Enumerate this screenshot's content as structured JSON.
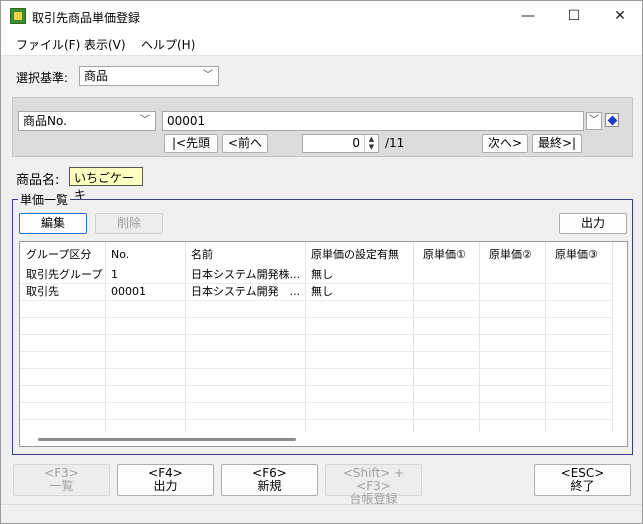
{
  "window": {
    "title": "取引先商品単価登録",
    "minimize": "—",
    "maximize": "☐",
    "close": "✕"
  },
  "menu": {
    "file": "ファイル(F)",
    "view": "表示(V)",
    "help": "ヘルプ(H)"
  },
  "criteria": {
    "label": "選択基準:",
    "value": "商品"
  },
  "search": {
    "field": "商品No.",
    "value": "00001",
    "first": "|<先頭",
    "prev": "<前へ",
    "position": "0",
    "total": "/11",
    "next": "次へ>",
    "last": "最終>|"
  },
  "product_name": {
    "label": "商品名:",
    "value": "いちごケーキ"
  },
  "price_list": {
    "title": "単価一覧",
    "edit": "編集",
    "delete": "削除",
    "output": "出力",
    "columns": [
      "グループ区分",
      "No.",
      "名前",
      "原単価の設定有無",
      "原単価①",
      "原単価②",
      "原単価③"
    ],
    "rows": [
      [
        "取引先グループ",
        "1",
        "日本システム開発株...",
        "無し",
        "",
        "",
        ""
      ],
      [
        "取引先",
        "00001",
        "日本システム開発　...",
        "無し",
        "",
        "",
        ""
      ]
    ]
  },
  "footer": {
    "f3_key": "<F3>",
    "f3_label": "一覧",
    "f4_key": "<F4>",
    "f4_label": "出力",
    "f6_key": "<F6>",
    "f6_label": "新規",
    "sf3_key": "<Shift> + <F3>",
    "sf3_label": "台帳登録",
    "esc_key": "<ESC>",
    "esc_label": "終了"
  }
}
